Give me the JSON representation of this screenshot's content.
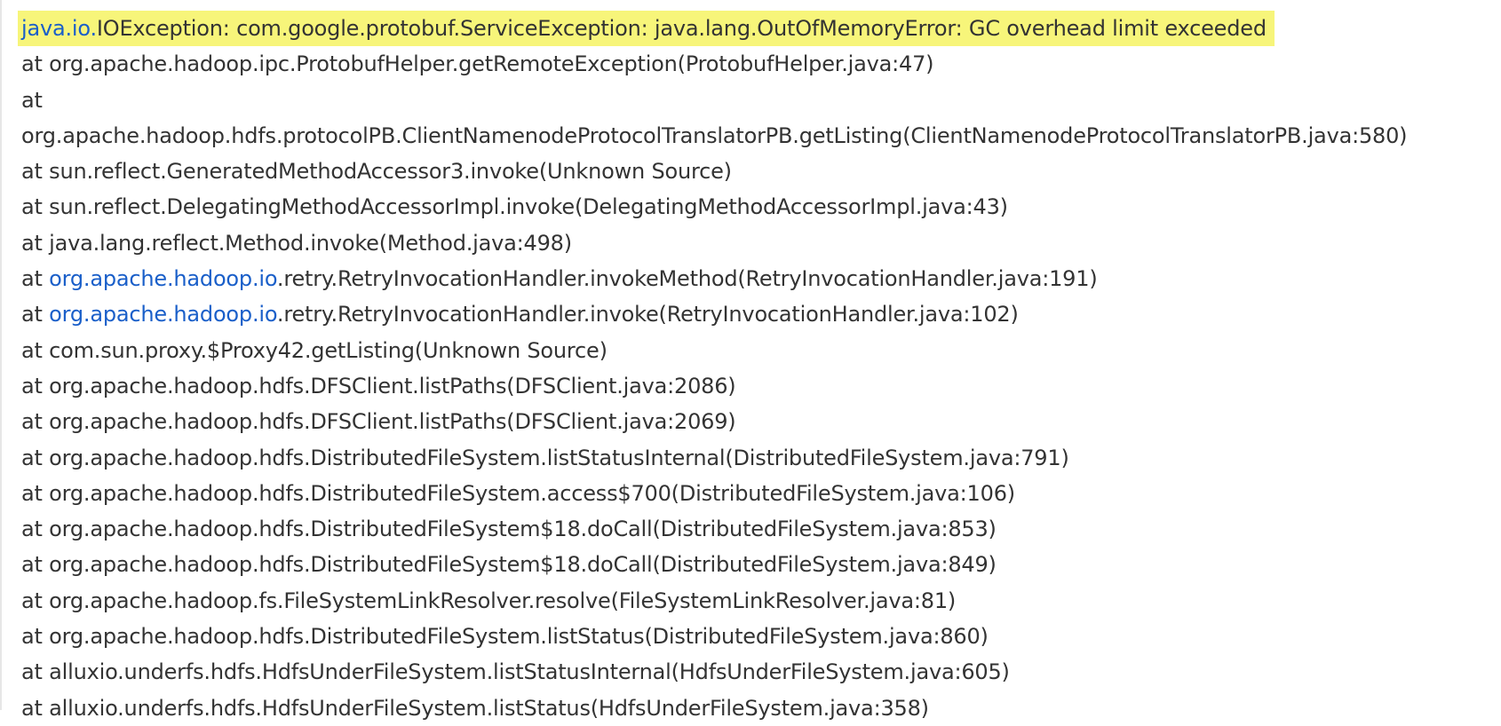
{
  "stack_trace": {
    "exception_line": {
      "link_part": "java.io.",
      "text_part": "IOException: com.google.protobuf.ServiceException: java.lang.OutOfMemoryError: GC overhead limit exceeded"
    },
    "lines": [
      "at org.apache.hadoop.ipc.ProtobufHelper.getRemoteException(ProtobufHelper.java:47)",
      "at",
      "org.apache.hadoop.hdfs.protocolPB.ClientNamenodeProtocolTranslatorPB.getListing(ClientNamenodeProtocolTranslatorPB.java:580)",
      "at sun.reflect.GeneratedMethodAccessor3.invoke(Unknown Source)",
      "at sun.reflect.DelegatingMethodAccessorImpl.invoke(DelegatingMethodAccessorImpl.java:43)",
      "at java.lang.reflect.Method.invoke(Method.java:498)"
    ],
    "retry_lines": [
      {
        "prefix": "at ",
        "link": "org.apache.hadoop.io",
        "suffix": ".retry.RetryInvocationHandler.invokeMethod(RetryInvocationHandler.java:191)"
      },
      {
        "prefix": "at ",
        "link": "org.apache.hadoop.io",
        "suffix": ".retry.RetryInvocationHandler.invoke(RetryInvocationHandler.java:102)"
      }
    ],
    "tail_lines": [
      "at com.sun.proxy.$Proxy42.getListing(Unknown Source)",
      "at org.apache.hadoop.hdfs.DFSClient.listPaths(DFSClient.java:2086)",
      "at org.apache.hadoop.hdfs.DFSClient.listPaths(DFSClient.java:2069)",
      "at org.apache.hadoop.hdfs.DistributedFileSystem.listStatusInternal(DistributedFileSystem.java:791)",
      "at org.apache.hadoop.hdfs.DistributedFileSystem.access$700(DistributedFileSystem.java:106)",
      "at org.apache.hadoop.hdfs.DistributedFileSystem$18.doCall(DistributedFileSystem.java:853)",
      "at org.apache.hadoop.hdfs.DistributedFileSystem$18.doCall(DistributedFileSystem.java:849)",
      "at org.apache.hadoop.fs.FileSystemLinkResolver.resolve(FileSystemLinkResolver.java:81)",
      "at org.apache.hadoop.hdfs.DistributedFileSystem.listStatus(DistributedFileSystem.java:860)",
      "at alluxio.underfs.hdfs.HdfsUnderFileSystem.listStatusInternal(HdfsUnderFileSystem.java:605)",
      "at alluxio.underfs.hdfs.HdfsUnderFileSystem.listStatus(HdfsUnderFileSystem.java:358)"
    ],
    "colors": {
      "highlight": "#f7f57a",
      "link": "#1a5fc9",
      "text": "#333333"
    }
  }
}
